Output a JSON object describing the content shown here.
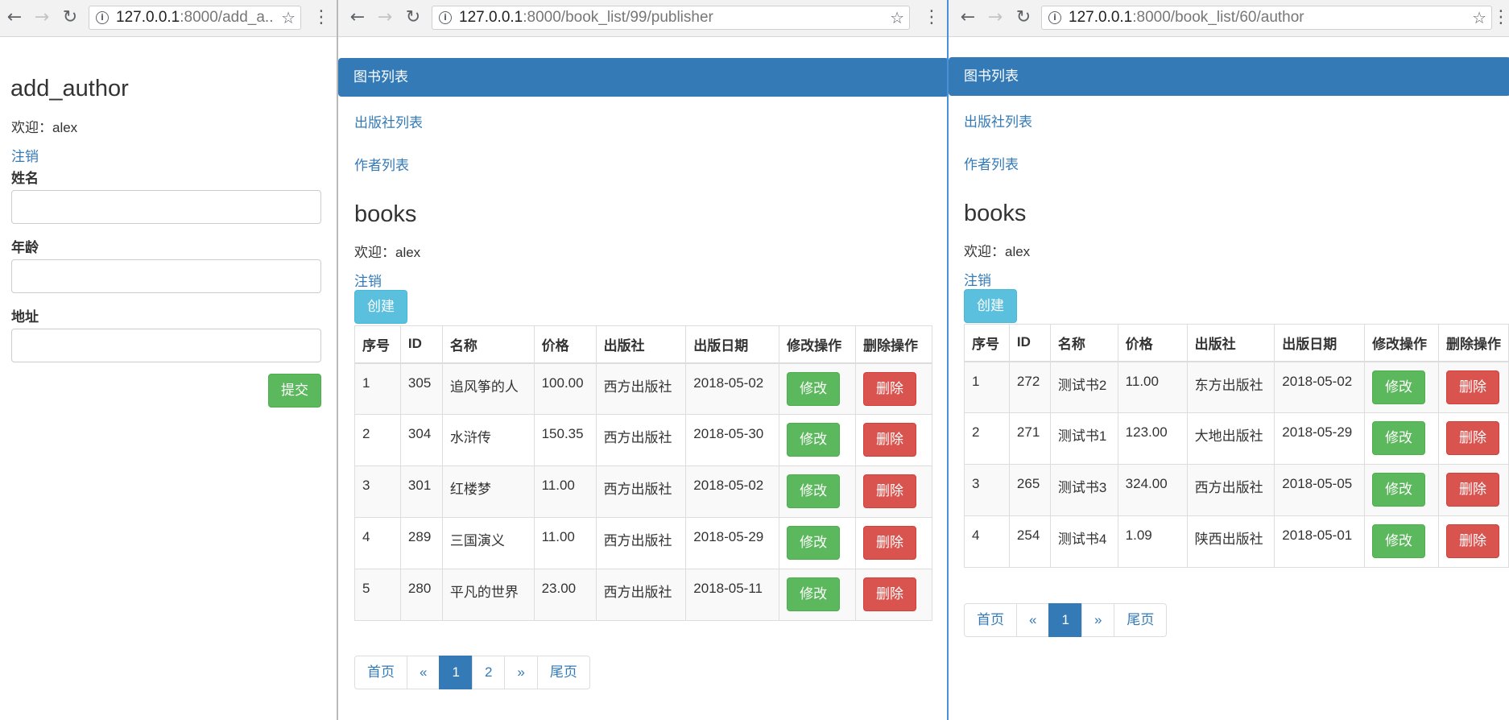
{
  "icons": {
    "back": "back-arrow-icon",
    "forward": "forward-arrow-icon",
    "reload": "reload-icon",
    "info": "info-icon",
    "star": "bookmark-star-icon",
    "menu": "kebab-menu-icon"
  },
  "colors": {
    "primary": "#337ab7",
    "success": "#5cb85c",
    "danger": "#d9534f",
    "info": "#5bc0de"
  },
  "win1": {
    "url_host": "127.0.0.1",
    "url_rest": ":8000/add_a...",
    "title": "add_author",
    "welcome": "欢迎：alex",
    "logout": "注销",
    "fields": [
      {
        "label": "姓名",
        "value": ""
      },
      {
        "label": "年龄",
        "value": ""
      },
      {
        "label": "地址",
        "value": ""
      }
    ],
    "submit": "提交"
  },
  "win2": {
    "url_host": "127.0.0.1",
    "url_rest": ":8000/book_list/99/publisher",
    "nav_brand": "图书列表",
    "nav_publisher": "出版社列表",
    "nav_author": "作者列表",
    "title": "books",
    "welcome": "欢迎：alex",
    "logout": "注销",
    "create": "创建",
    "headers": [
      "序号",
      "ID",
      "名称",
      "价格",
      "出版社",
      "出版日期",
      "修改操作",
      "删除操作"
    ],
    "rows": [
      [
        "1",
        "305",
        "追风筝的人",
        "100.00",
        "西方出版社",
        "2018-05-02"
      ],
      [
        "2",
        "304",
        "水浒传",
        "150.35",
        "西方出版社",
        "2018-05-30"
      ],
      [
        "3",
        "301",
        "红楼梦",
        "11.00",
        "西方出版社",
        "2018-05-02"
      ],
      [
        "4",
        "289",
        "三国演义",
        "11.00",
        "西方出版社",
        "2018-05-29"
      ],
      [
        "5",
        "280",
        "平凡的世界",
        "23.00",
        "西方出版社",
        "2018-05-11"
      ]
    ],
    "edit_label": "修改",
    "delete_label": "删除",
    "pager": [
      "首页",
      "«",
      "1",
      "2",
      "»",
      "尾页"
    ]
  },
  "win3": {
    "url_host": "127.0.0.1",
    "url_rest": ":8000/book_list/60/author",
    "nav_brand": "图书列表",
    "nav_publisher": "出版社列表",
    "nav_author": "作者列表",
    "title": "books",
    "welcome": "欢迎：alex",
    "logout": "注销",
    "create": "创建",
    "headers": [
      "序号",
      "ID",
      "名称",
      "价格",
      "出版社",
      "出版日期",
      "修改操作",
      "删除操作"
    ],
    "rows": [
      [
        "1",
        "272",
        "测试书2",
        "11.00",
        "东方出版社",
        "2018-05-02"
      ],
      [
        "2",
        "271",
        "测试书1",
        "123.00",
        "大地出版社",
        "2018-05-29"
      ],
      [
        "3",
        "265",
        "测试书3",
        "324.00",
        "西方出版社",
        "2018-05-05"
      ],
      [
        "4",
        "254",
        "测试书4",
        "1.09",
        "陕西出版社",
        "2018-05-01"
      ]
    ],
    "edit_label": "修改",
    "delete_label": "删除",
    "pager": [
      "首页",
      "«",
      "1",
      "»",
      "尾页"
    ]
  }
}
